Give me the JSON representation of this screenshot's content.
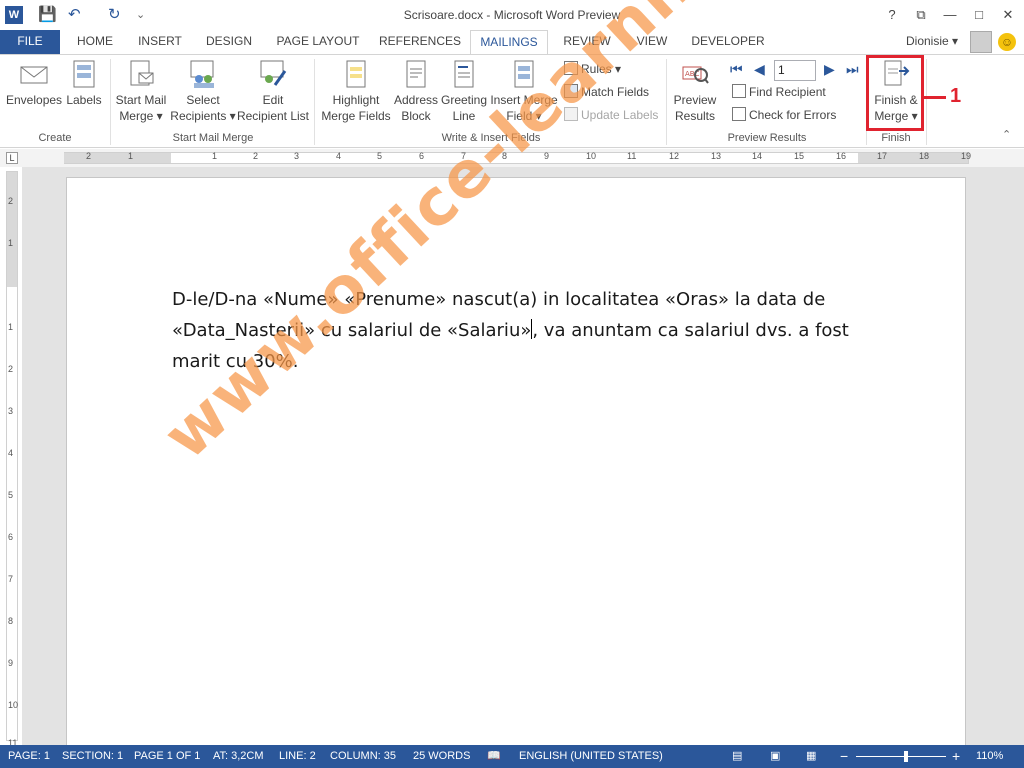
{
  "window": {
    "title": "Scrisoare.docx - Microsoft Word Preview",
    "help": "?",
    "minimize": "—",
    "maximize": "□",
    "close": "✕",
    "restore": "⧉"
  },
  "qat": {
    "word_logo": "W",
    "save": "💾",
    "undo": "↶",
    "redo": "↻",
    "customize": "⌄"
  },
  "tabs": [
    {
      "label": "FILE"
    },
    {
      "label": "HOME"
    },
    {
      "label": "INSERT"
    },
    {
      "label": "DESIGN"
    },
    {
      "label": "PAGE LAYOUT"
    },
    {
      "label": "REFERENCES"
    },
    {
      "label": "MAILINGS"
    },
    {
      "label": "REVIEW"
    },
    {
      "label": "VIEW"
    },
    {
      "label": "DEVELOPER"
    }
  ],
  "user": {
    "name": "Dionisie ▾"
  },
  "ribbon": {
    "groups": {
      "create": "Create",
      "start_mail_merge": "Start Mail Merge",
      "write_insert": "Write & Insert Fields",
      "preview_results": "Preview Results",
      "finish": "Finish"
    },
    "buttons": {
      "envelopes": "Envelopes",
      "labels": "Labels",
      "start_mail_merge_1": "Start Mail",
      "start_mail_merge_2": "Merge ▾",
      "select_recipients_1": "Select",
      "select_recipients_2": "Recipients ▾",
      "edit_recipient_1": "Edit",
      "edit_recipient_2": "Recipient List",
      "highlight_1": "Highlight",
      "highlight_2": "Merge Fields",
      "address_1": "Address",
      "address_2": "Block",
      "greeting_1": "Greeting",
      "greeting_2": "Line",
      "insert_merge_1": "Insert Merge",
      "insert_merge_2": "Field ▾",
      "rules": "Rules ▾",
      "match_fields": "Match Fields",
      "update_labels": "Update Labels",
      "preview_1": "Preview",
      "preview_2": "Results",
      "record_value": "1",
      "find_recipient": "Find Recipient",
      "check_errors": "Check for Errors",
      "finish_1": "Finish &",
      "finish_2": "Merge ▾"
    },
    "annotation": "1"
  },
  "ruler": {
    "h_ticks": [
      "2",
      "1",
      "1",
      "1",
      "2",
      "3",
      "4",
      "5",
      "6",
      "7",
      "8",
      "9",
      "10",
      "11",
      "12",
      "13",
      "14",
      "15",
      "16",
      "17",
      "18",
      "19"
    ],
    "v_ticks": [
      "2",
      "1",
      "1",
      "2",
      "3",
      "4",
      "5",
      "6",
      "7",
      "8",
      "9",
      "10",
      "11"
    ],
    "corner": "L"
  },
  "document": {
    "text_before_caret": "D-le/D-na «Nume» «Prenume» nascut(a) in localitatea «Oras» la data de «Data_Nasterii» cu salariul de «Salariu»",
    "text_after_caret": ", va anuntam ca salariul dvs. a fost marit cu 30%.",
    "watermark": "www.office-learning.ro"
  },
  "status": {
    "page": "PAGE: 1",
    "section": "SECTION: 1",
    "page_of": "PAGE 1 OF 1",
    "at": "AT: 3,2CM",
    "line": "LINE: 2",
    "column": "COLUMN: 35",
    "words": "25 WORDS",
    "language": "ENGLISH (UNITED STATES)",
    "zoom_minus": "−",
    "zoom_plus": "+",
    "zoom": "110%",
    "zoom_level": 0.55
  },
  "colors": {
    "accent": "#2b579a",
    "annotation": "#e0232f",
    "watermark": "#f79646"
  }
}
